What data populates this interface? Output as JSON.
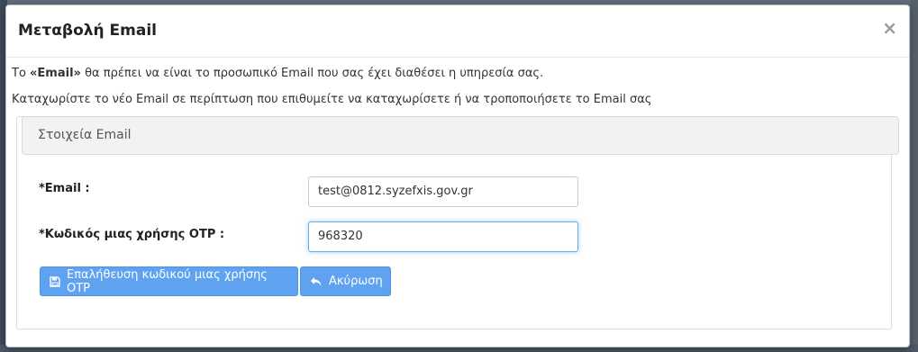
{
  "modal": {
    "title": "Μεταβολή Email",
    "close_symbol": "×"
  },
  "intro": {
    "line1_prefix": "Το ",
    "line1_bold": "«Email»",
    "line1_suffix": " θα πρέπει να είναι το προσωπικό Email που σας έχει διαθέσει η υπηρεσία σας.",
    "line2": "Καταχωρίστε το νέο Email σε περίπτωση που επιθυμείτε να καταχωρίσετε ή να τροποποιήσετε το Email σας"
  },
  "section": {
    "title": "Στοιχεία Email"
  },
  "form": {
    "email_label": "*Email :",
    "email_value": "test@0812.syzefxis.gov.gr",
    "otp_label": "*Κωδικός μιας χρήσης OTP :",
    "otp_value": "968320"
  },
  "buttons": {
    "verify_label": "Επαλήθευση κωδικού μιας χρήσης OTP",
    "verify_icon": "save-icon",
    "cancel_label": "Ακύρωση",
    "cancel_icon": "undo-icon"
  },
  "colors": {
    "primary_button": "#5fa2f0",
    "focus_border": "#66afe9"
  }
}
